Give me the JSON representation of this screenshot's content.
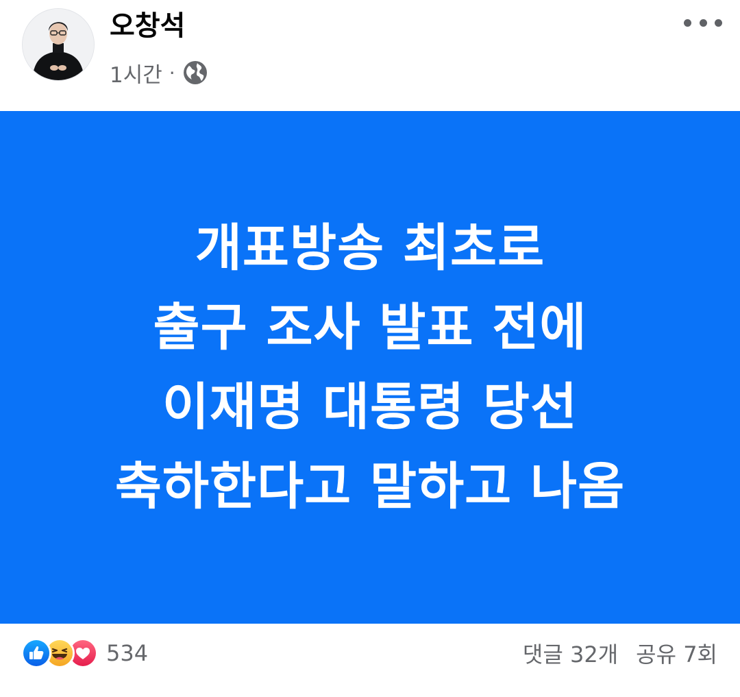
{
  "post": {
    "author": "오창석",
    "time": "1시간",
    "separator": "·",
    "privacy_icon": "globe-icon",
    "more_icon": "more-horizontal-icon",
    "background_color": "#0a73f8",
    "text_color": "#ffffff",
    "lines": [
      "개표방송 최초로",
      "출구 조사 발표 전에",
      "이재명 대통령 당선",
      "축하한다고 말하고 나옴"
    ]
  },
  "reactions": {
    "icons": [
      "like-icon",
      "haha-icon",
      "love-icon"
    ],
    "count": "534"
  },
  "stats": {
    "comments": "댓글 32개",
    "shares": "공유 7회"
  }
}
